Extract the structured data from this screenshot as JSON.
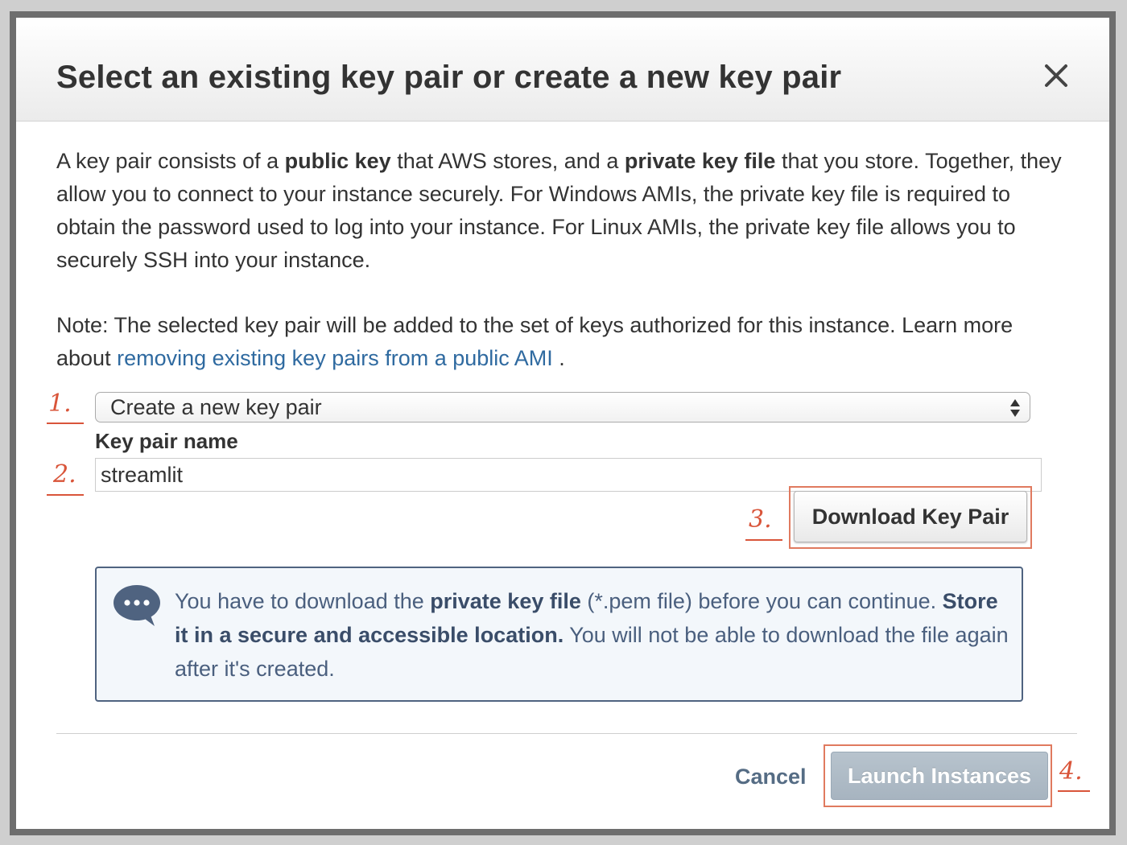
{
  "dialog": {
    "title": "Select an existing key pair or create a new key pair",
    "close_label": "×"
  },
  "description": {
    "p1_a": "A key pair consists of a ",
    "p1_b": "public key",
    "p1_c": " that AWS stores, and a ",
    "p1_d": "private key file",
    "p1_e": " that you store. Together, they allow you to connect to your instance securely. For Windows AMIs, the private key file is required to obtain the password used to log into your instance. For Linux AMIs, the private key file allows you to securely SSH into your instance.",
    "p2_a": "Note: The selected key pair will be added to the set of keys authorized for this instance. Learn more about ",
    "p2_link": "removing existing key pairs from a public AMI",
    "p2_b": " ."
  },
  "key_pair_select": {
    "value": "Create a new key pair"
  },
  "key_pair_name": {
    "label": "Key pair name",
    "value": "streamlit"
  },
  "download_button": {
    "label": "Download Key Pair"
  },
  "notice": {
    "t1": "You have to download the ",
    "t2": "private key file",
    "t3": " (*.pem file) before you can continue. ",
    "t4": "Store it in a secure and accessible location.",
    "t5": " You will not be able to download the file again after it's created."
  },
  "footer": {
    "cancel_label": "Cancel",
    "launch_label": "Launch Instances"
  },
  "annotations": {
    "a1": "1.",
    "a2": "2.",
    "a3": "3.",
    "a4": "4."
  },
  "colors": {
    "annotation": "#d9553a",
    "link": "#2f6aa0",
    "notice_border": "#4f6380",
    "launch_disabled": "#a7b4c0"
  },
  "icons": {
    "close": "close-icon",
    "select_arrows": "select-arrows-icon",
    "notice": "chat-bubble-icon"
  }
}
